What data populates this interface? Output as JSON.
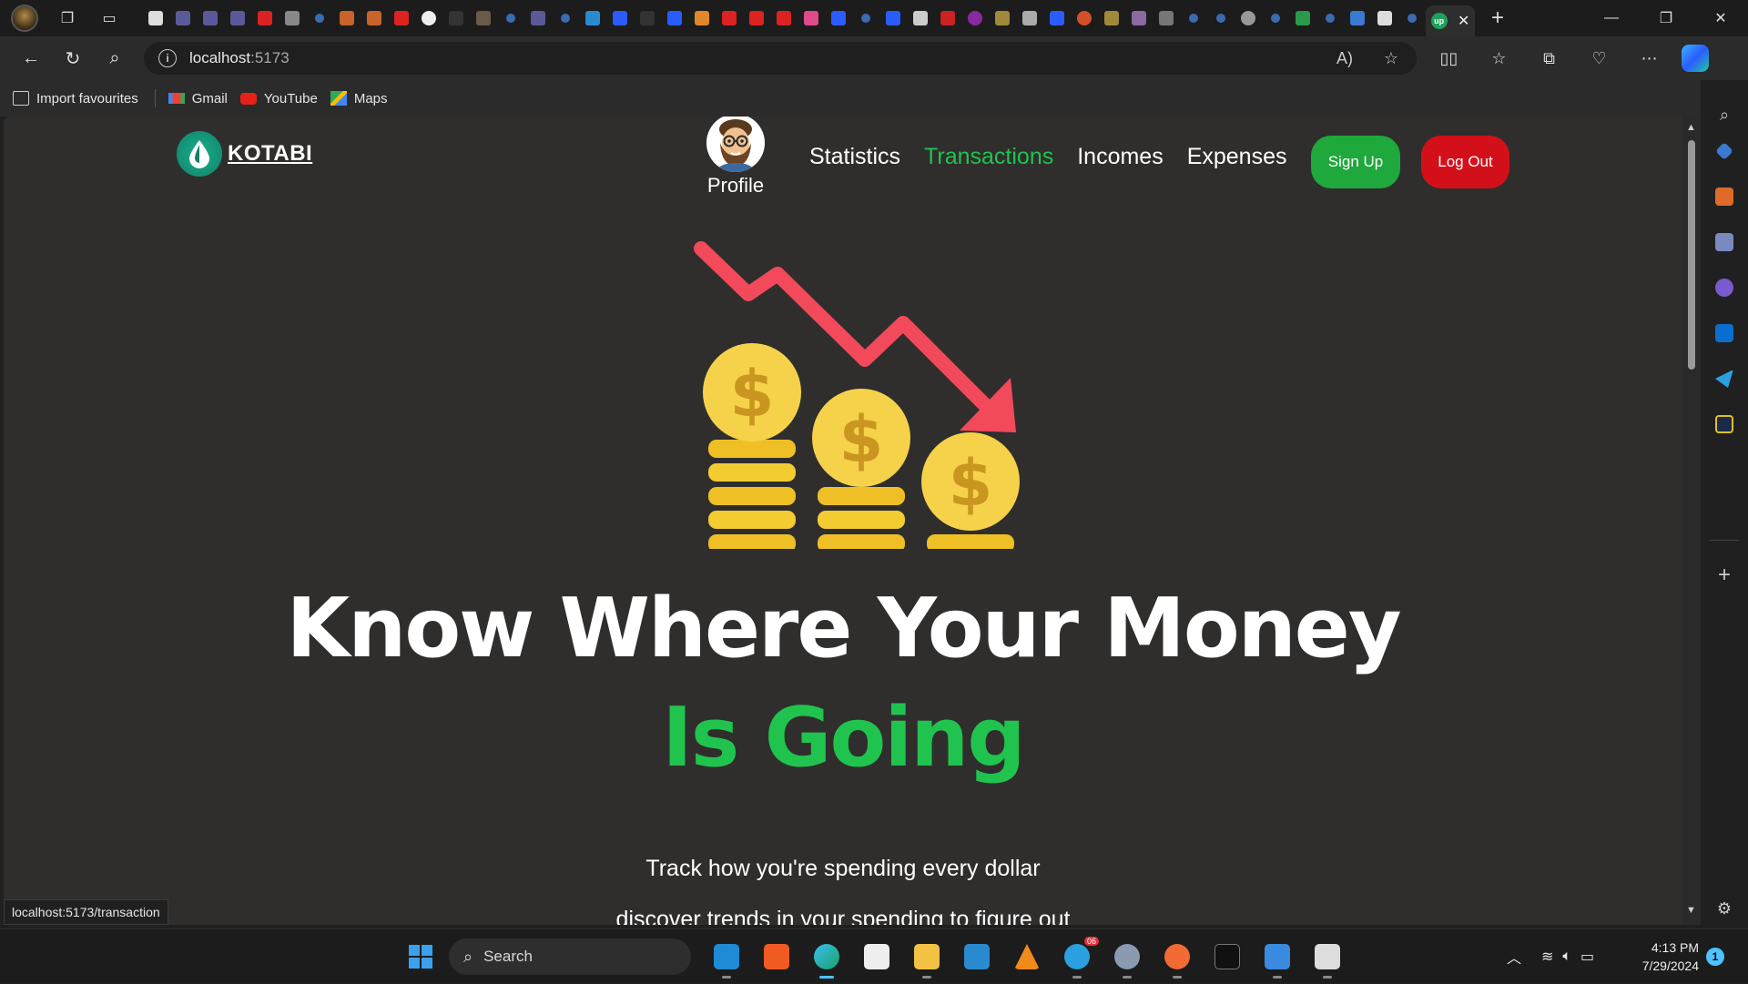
{
  "browser": {
    "url_host": "localhost",
    "url_port": ":5173",
    "favourites": [
      {
        "label": "Import favourites"
      },
      {
        "label": "Gmail"
      },
      {
        "label": "YouTube"
      },
      {
        "label": "Maps"
      }
    ],
    "status_url": "localhost:5173/transaction",
    "active_tab_favicon_text": "up"
  },
  "navbar": {
    "brand": "KOTABI",
    "profile_label": "Profile",
    "links": [
      "Statistics",
      "Transactions",
      "Incomes",
      "Expenses"
    ],
    "active_link": "Transactions",
    "signup_label": "Sign Up",
    "logout_label": "Log Out"
  },
  "hero": {
    "line1": "Know Where Your Money",
    "line2": "Is Going",
    "sub1": "Track how you're spending every dollar",
    "sub2": "discover trends in your spending to figure out"
  },
  "taskbar": {
    "search_label": "Search",
    "time": "4:13 PM",
    "date": "7/29/2024",
    "notification_count": "1",
    "telegram_badge": "06"
  },
  "colors": {
    "accent_green": "#20c34e",
    "signup_green": "#1fa83c",
    "logout_red": "#d3101a",
    "page_bg": "#2f2e2d",
    "arrow_red": "#f2495b",
    "coin_gold": "#f2c82c"
  }
}
